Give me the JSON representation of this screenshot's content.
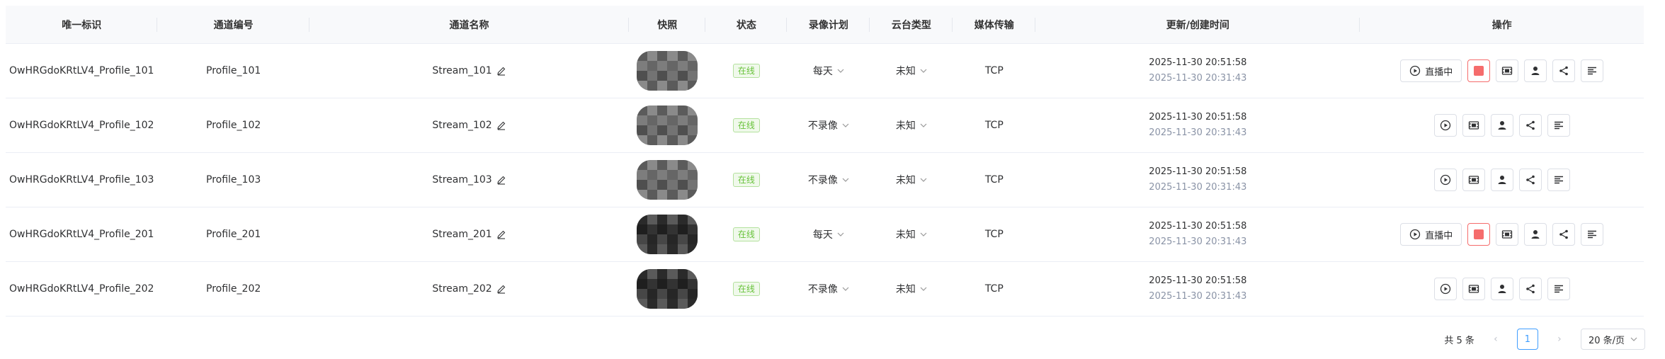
{
  "columns": [
    "唯一标识",
    "通道编号",
    "通道名称",
    "快照",
    "状态",
    "录像计划",
    "云台类型",
    "媒体传输",
    "更新/创建时间",
    "操作"
  ],
  "rows": [
    {
      "uid": "OwHRGdoKRtLV4_Profile_101",
      "channel_id": "Profile_101",
      "channel_name": "Stream_101",
      "status": "在线",
      "record_plan": "每天",
      "ptz_type": "未知",
      "transport": "TCP",
      "updated": "2025-11-30 20:51:58",
      "created": "2025-11-30 20:31:43",
      "live": true,
      "snapshot_tone": "gray"
    },
    {
      "uid": "OwHRGdoKRtLV4_Profile_102",
      "channel_id": "Profile_102",
      "channel_name": "Stream_102",
      "status": "在线",
      "record_plan": "不录像",
      "ptz_type": "未知",
      "transport": "TCP",
      "updated": "2025-11-30 20:51:58",
      "created": "2025-11-30 20:31:43",
      "live": false,
      "snapshot_tone": "gray"
    },
    {
      "uid": "OwHRGdoKRtLV4_Profile_103",
      "channel_id": "Profile_103",
      "channel_name": "Stream_103",
      "status": "在线",
      "record_plan": "不录像",
      "ptz_type": "未知",
      "transport": "TCP",
      "updated": "2025-11-30 20:51:58",
      "created": "2025-11-30 20:31:43",
      "live": false,
      "snapshot_tone": "gray"
    },
    {
      "uid": "OwHRGdoKRtLV4_Profile_201",
      "channel_id": "Profile_201",
      "channel_name": "Stream_201",
      "status": "在线",
      "record_plan": "每天",
      "ptz_type": "未知",
      "transport": "TCP",
      "updated": "2025-11-30 20:51:58",
      "created": "2025-11-30 20:31:43",
      "live": true,
      "snapshot_tone": "dark"
    },
    {
      "uid": "OwHRGdoKRtLV4_Profile_202",
      "channel_id": "Profile_202",
      "channel_name": "Stream_202",
      "status": "在线",
      "record_plan": "不录像",
      "ptz_type": "未知",
      "transport": "TCP",
      "updated": "2025-11-30 20:51:58",
      "created": "2025-11-30 20:31:43",
      "live": false,
      "snapshot_tone": "dark"
    }
  ],
  "live_label": "直播中",
  "pagination": {
    "total_label": "共 5 条",
    "current_page": "1",
    "page_size_label": "20 条/页",
    "prev_icon": "chevron-left-icon",
    "next_icon": "chevron-right-icon"
  },
  "colors": {
    "accent": "#409eff",
    "online": "#67c23a",
    "stop": "#f56c6c",
    "header_bg": "#f8f9fb"
  }
}
